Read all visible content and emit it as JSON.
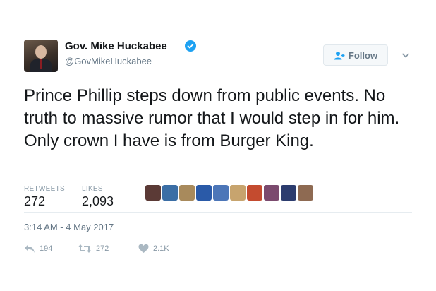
{
  "author": {
    "name": "Gov. Mike Huckabee",
    "handle": "@GovMikeHuckabee"
  },
  "follow_button": {
    "label": "Follow"
  },
  "tweet": {
    "text": "Prince Phillip steps down from public events. No truth to massive rumor that I would step in for him. Only crown I have is from Burger King.",
    "timestamp": "3:14 AM - 4 May 2017"
  },
  "stats": {
    "retweets_label": "RETWEETS",
    "retweets_value": "272",
    "likes_label": "LIKES",
    "likes_value": "2,093"
  },
  "likers": [
    {
      "color": "#5b3a36"
    },
    {
      "color": "#3b6ea5"
    },
    {
      "color": "#a88a5c"
    },
    {
      "color": "#2a5aa8"
    },
    {
      "color": "#4c76b8"
    },
    {
      "color": "#c7a46e"
    },
    {
      "color": "#c44b2f"
    },
    {
      "color": "#7b4a6e"
    },
    {
      "color": "#2c3c6e"
    },
    {
      "color": "#8e6a52"
    }
  ],
  "actions": {
    "reply_count": "194",
    "retweet_count": "272",
    "like_count": "2.1K"
  },
  "colors": {
    "verified": "#1da1f2",
    "text_primary": "#14171a",
    "text_secondary": "#657786"
  }
}
